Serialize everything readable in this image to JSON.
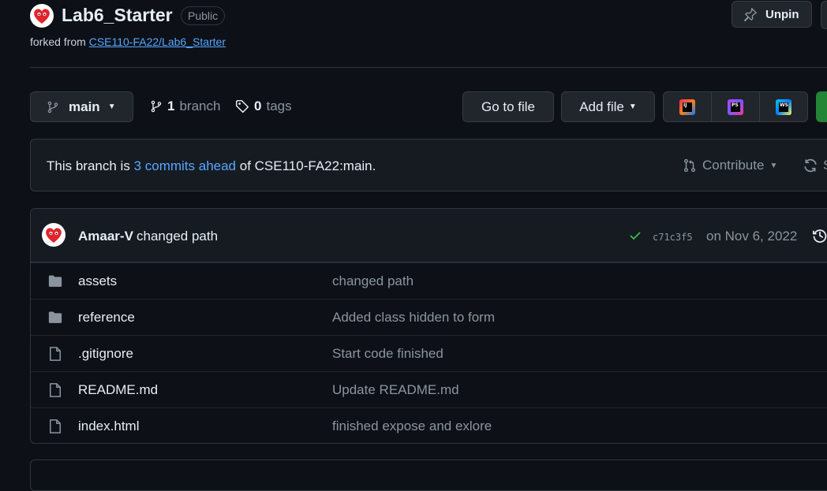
{
  "repo": {
    "name": "Lab6_Starter",
    "visibility": "Public",
    "forked_prefix": "forked from",
    "forked_source": "CSE110-FA22/Lab6_Starter",
    "unpin_label": "Unpin"
  },
  "toolbar": {
    "branch_name": "main",
    "branch_count": "1",
    "branch_word": "branch",
    "tag_count": "0",
    "tag_word": "tags",
    "go_to_file_label": "Go to file",
    "add_file_label": "Add file"
  },
  "ide_buttons": [
    {
      "icon": "intellij-icon",
      "abbr": "IJ"
    },
    {
      "icon": "phpstorm-icon",
      "abbr": "PS"
    },
    {
      "icon": "webstorm-icon",
      "abbr": "WS"
    }
  ],
  "banner": {
    "prefix": "This branch is",
    "ahead_link": "3 commits ahead",
    "suffix": "of CSE110-FA22:main.",
    "contribute_label": "Contribute",
    "sync_label": "S"
  },
  "commit": {
    "author": "Amaar-V",
    "message": "changed path",
    "sha": "c71c3f5",
    "date": "on Nov 6, 2022"
  },
  "files": [
    {
      "type": "folder",
      "name": "assets",
      "message": "changed path"
    },
    {
      "type": "folder",
      "name": "reference",
      "message": "Added class hidden to form"
    },
    {
      "type": "file",
      "name": ".gitignore",
      "message": "Start code finished"
    },
    {
      "type": "file",
      "name": "README.md",
      "message": "Update README.md"
    },
    {
      "type": "file",
      "name": "index.html",
      "message": "finished expose and exlore"
    }
  ],
  "colors": {
    "background": "#0d1117",
    "link": "#58a6ff",
    "success": "#3fb950",
    "code_button": "#238636"
  }
}
